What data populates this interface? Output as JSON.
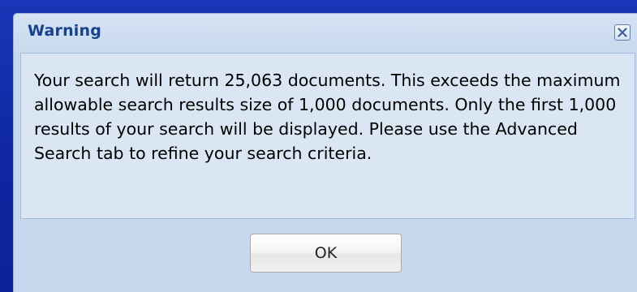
{
  "dialog": {
    "title": "Warning",
    "close_icon": "close-icon",
    "message": "Your search will return 25,063 documents. This exceeds the maximum allowable search results size of 1,000 documents. Only the first 1,000 results of your search will be displayed. Please use the Advanced Search tab to refine your search criteria.",
    "ok_label": "OK"
  },
  "colors": {
    "background": "#0f2aa6",
    "dialog_bg": "#c8d8ee",
    "title_text": "#15428b",
    "body_panel": "#dbe6f4"
  }
}
